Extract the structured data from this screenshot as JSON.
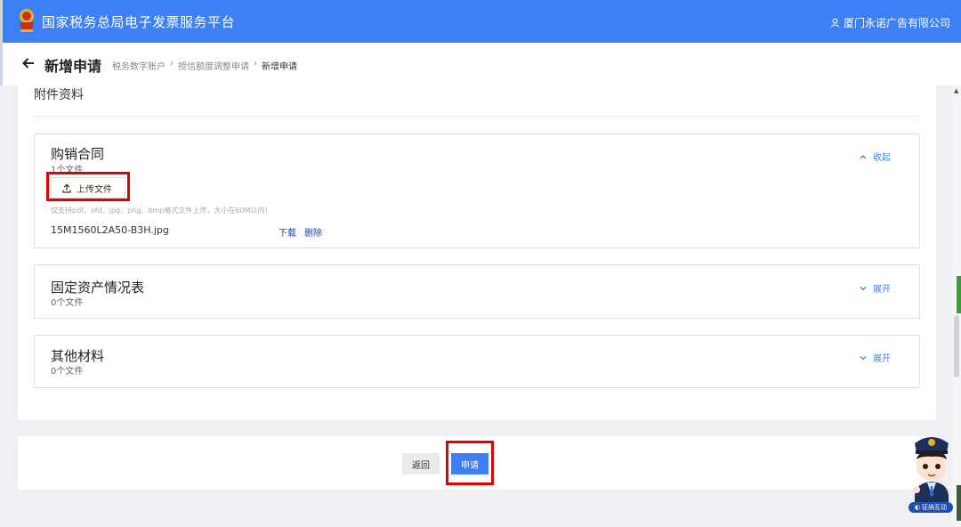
{
  "header": {
    "brand": "国家税务总局电子发票服务平台",
    "user": "厦门永诺广告有限公司"
  },
  "nav": {
    "title": "新增申请",
    "breadcrumbs": [
      "税务数字账户",
      "授信额度调整申请",
      "新增申请"
    ]
  },
  "section": {
    "title": "附件资料"
  },
  "cards": {
    "contract": {
      "name": "购销合同",
      "count": "1个文件",
      "toggle": "收起",
      "upload_label": "上传文件",
      "hint": "仅支持pdf、ofd、jpg、png、bmp格式文件上传，大小在60M以内！",
      "file": {
        "name": "15M1560L2A50-B3H.jpg",
        "download": "下载",
        "delete": "删除"
      }
    },
    "fixed_assets": {
      "name": "固定资产情况表",
      "count": "0个文件",
      "toggle": "展开"
    },
    "other": {
      "name": "其他材料",
      "count": "0个文件",
      "toggle": "展开"
    }
  },
  "footer": {
    "back": "返回",
    "apply": "申请"
  },
  "mascot": {
    "tag": "征纳互动"
  },
  "colors": {
    "primary": "#3d7ff5",
    "highlight": "#e10000",
    "link": "#1a3fb0"
  }
}
